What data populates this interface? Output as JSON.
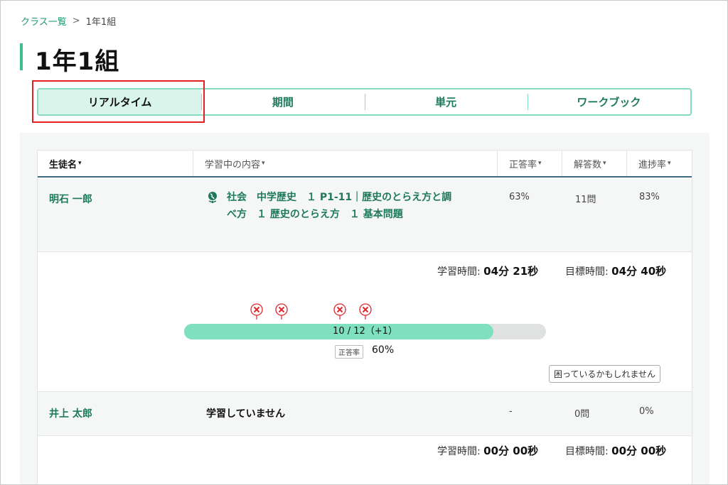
{
  "breadcrumb": {
    "parent": "クラス一覧",
    "separator": ">",
    "current": "1年1組"
  },
  "page_title": "1年1組",
  "tabs": [
    {
      "label": "リアルタイム",
      "active": true
    },
    {
      "label": "期間",
      "active": false
    },
    {
      "label": "単元",
      "active": false
    },
    {
      "label": "ワークブック",
      "active": false
    }
  ],
  "table": {
    "headers": {
      "student": "生徒名",
      "content": "学習中の内容",
      "accuracy": "正答率",
      "answers": "解答数",
      "progress": "進捗率"
    },
    "caret": "▾",
    "rows": [
      {
        "student": "明石 一郎",
        "content_line1": "社会　中学歴史　１ P1-11｜歴史のとらえ方と調",
        "content_line2": "べ方　１ 歴史のとらえ方　１ 基本問題",
        "accuracy": "63%",
        "answers": "11問",
        "progress": "83%",
        "study_time_label": "学習時間:",
        "study_time": "04分 21秒",
        "goal_time_label": "目標時間:",
        "goal_time": "04分 40秒",
        "progress_text": "10 / 12（+1）",
        "progress_fraction": 0.855,
        "wrong_marker_positions": [
          0.2,
          0.27,
          0.43,
          0.5
        ],
        "accuracy_badge": "正答率",
        "accuracy_value": "60%",
        "help_button": "困っているかもしれません"
      },
      {
        "student": "井上 太郎",
        "content_status": "学習していません",
        "accuracy": "-",
        "answers": "0問",
        "progress": "0%",
        "study_time_label": "学習時間:",
        "study_time": "00分 00秒",
        "goal_time_label": "目標時間:",
        "goal_time": "00分 00秒"
      }
    ]
  },
  "colors": {
    "accent": "#3cbf8c",
    "link": "#1e7a5a",
    "bar_fill": "#7ee0bf",
    "wrong_marker": "#e0262c",
    "highlight": "#e62020"
  }
}
